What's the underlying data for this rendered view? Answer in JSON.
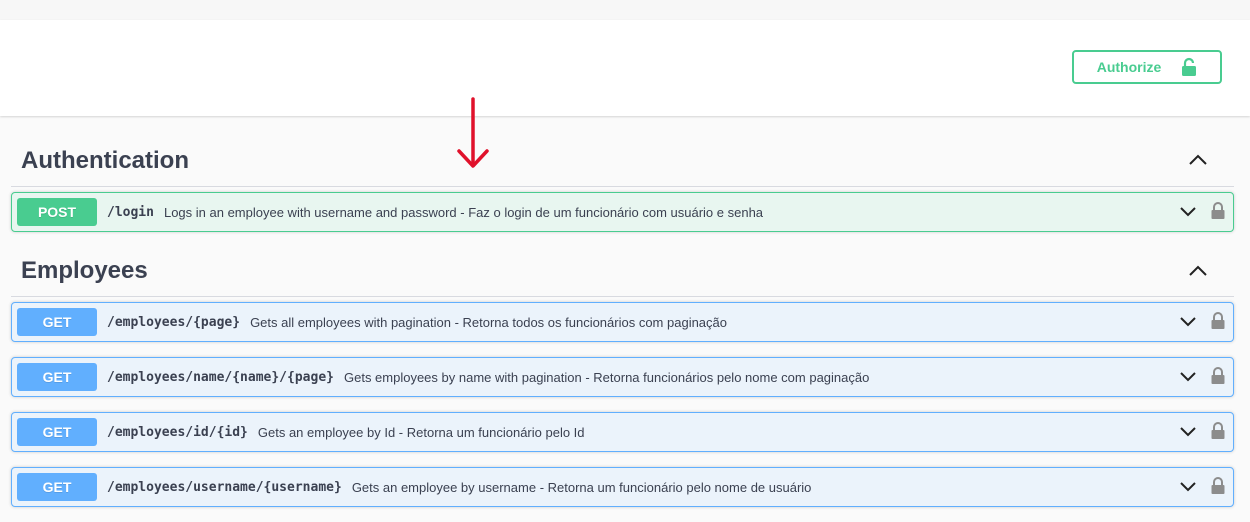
{
  "header": {
    "authorize_label": "Authorize"
  },
  "sections": [
    {
      "title": "Authentication",
      "ops": [
        {
          "method": "POST",
          "path": "/login",
          "summary": "Logs in an employee with username and password - Faz o login de um funcionário com usuário e senha"
        }
      ]
    },
    {
      "title": "Employees",
      "ops": [
        {
          "method": "GET",
          "path": "/employees/{page}",
          "summary": "Gets all employees with pagination - Retorna todos os funcionários com paginação"
        },
        {
          "method": "GET",
          "path": "/employees/name/{name}/{page}",
          "summary": "Gets employees by name with pagination - Retorna funcionários pelo nome com paginação"
        },
        {
          "method": "GET",
          "path": "/employees/id/{id}",
          "summary": "Gets an employee by Id - Retorna um funcionário pelo Id"
        },
        {
          "method": "GET",
          "path": "/employees/username/{username}",
          "summary": "Gets an employee by username - Retorna um funcionário pelo nome de usuário"
        }
      ]
    }
  ],
  "colors": {
    "post": "#49cc90",
    "get": "#61affe",
    "annotation_arrow": "#e0112b"
  },
  "icons": {
    "authorize": "unlocked-lock-icon",
    "collapse": "chevron-up-icon",
    "expand": "chevron-down-icon",
    "lock": "lock-icon",
    "annotation": "arrow-down-icon"
  }
}
